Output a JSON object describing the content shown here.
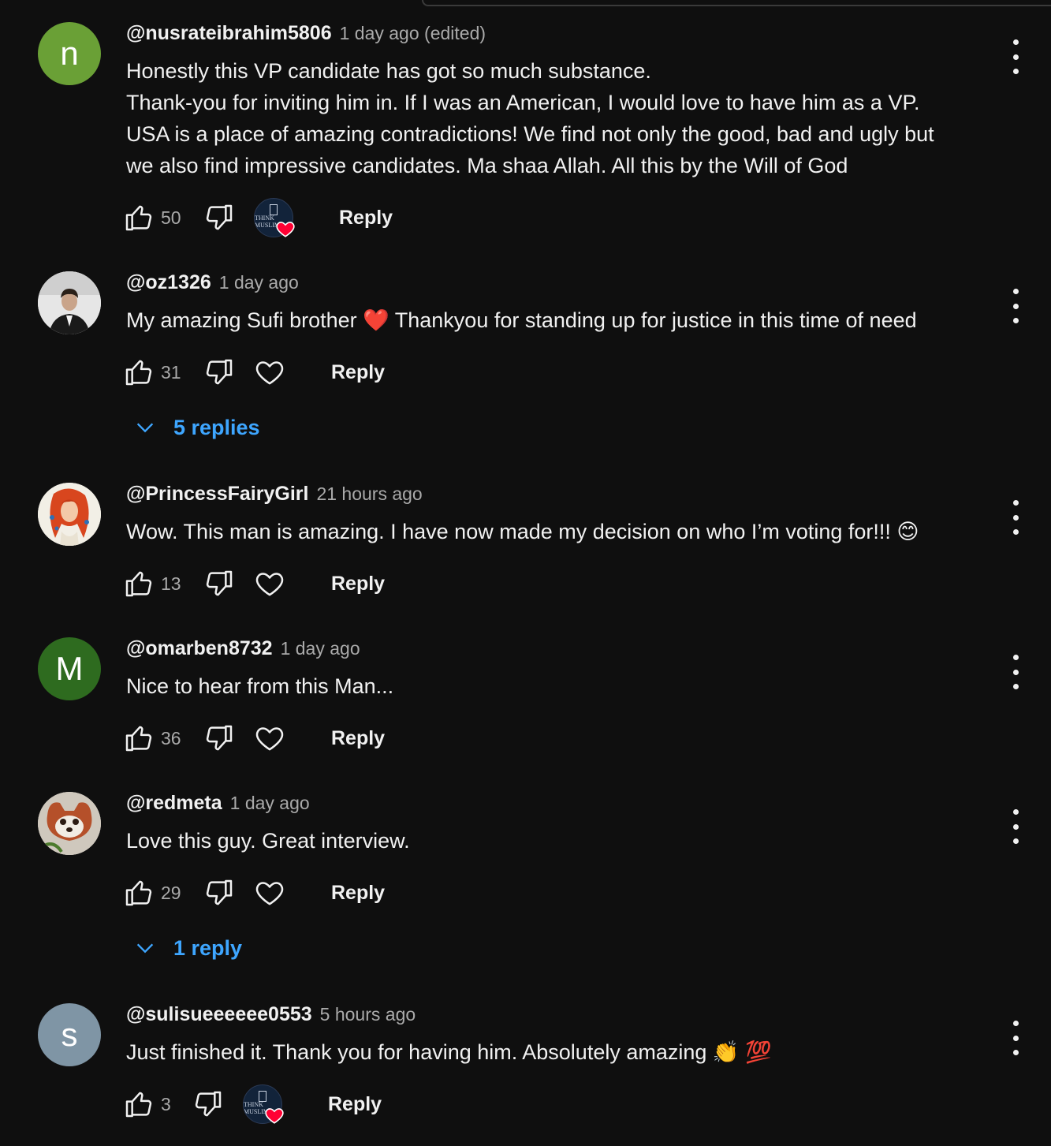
{
  "comments": [
    {
      "author": "@nusrateibrahim5806",
      "time": "1 day ago (edited)",
      "avatar_letter": "n",
      "avatar_color": "#6aa036",
      "lines": [
        "Honestly this VP candidate has got so much substance.",
        "Thank-you for inviting him in. If I was an American, I would love to have him as a VP.",
        "USA is a place of amazing contradictions! We find not only the good, bad and ugly but",
        "we also find impressive candidates. Ma shaa Allah. All this by the Will of God"
      ],
      "likes": "50",
      "hearted_by_creator": true,
      "reply_label": "Reply"
    },
    {
      "author": "@oz1326",
      "time": "1 day ago",
      "avatar": "man-in-suit-photo",
      "lines": [
        "My amazing Sufi brother ❤️ Thankyou for standing up for justice in this time of need"
      ],
      "likes": "31",
      "hearted_by_creator": false,
      "reply_label": "Reply",
      "replies_label": "5 replies"
    },
    {
      "author": "@PrincessFairyGirl",
      "time": "21 hours ago",
      "avatar": "red-haired-woman-illustration",
      "lines": [
        "Wow. This man is amazing. I have now made my decision on who I’m voting for!!! 😊"
      ],
      "likes": "13",
      "hearted_by_creator": false,
      "reply_label": "Reply"
    },
    {
      "author": "@omarben8732",
      "time": "1 day ago",
      "avatar_letter": "M",
      "avatar_color": "#2e6b1f",
      "lines": [
        "Nice to hear from this Man..."
      ],
      "likes": "36",
      "hearted_by_creator": false,
      "reply_label": "Reply"
    },
    {
      "author": "@redmeta",
      "time": "1 day ago",
      "avatar": "red-panda-photo",
      "lines": [
        "Love this guy. Great interview."
      ],
      "likes": "29",
      "hearted_by_creator": false,
      "reply_label": "Reply",
      "replies_label": "1 reply"
    },
    {
      "author": "@sulisueeeeee0553",
      "time": "5 hours ago",
      "avatar_letter": "s",
      "avatar_color": "#7f95a5",
      "lines": [
        "Just finished it. Thank you for having him. Absolutely amazing 👏 💯"
      ],
      "likes": "3",
      "hearted_by_creator": true,
      "reply_label": "Reply"
    }
  ],
  "creator_avatar_text": "THINK MUSLIM",
  "colors": {
    "background": "#0f0f0f",
    "link": "#3ea6ff",
    "secondary_text": "#aaaaaa",
    "heart": "#ff0033"
  }
}
